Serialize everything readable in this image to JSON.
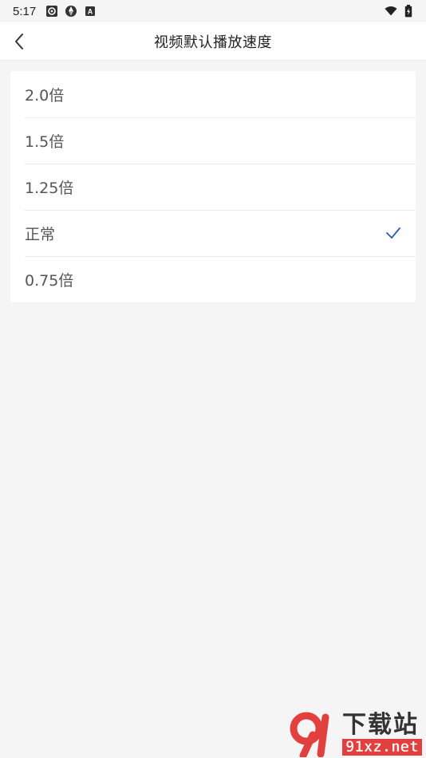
{
  "status_bar": {
    "time": "5:17",
    "left_icons": [
      "app-notification-icon",
      "aperture-icon",
      "a-letter-icon"
    ],
    "right_icons": [
      "wifi-icon",
      "battery-icon"
    ]
  },
  "header": {
    "title": "视频默认播放速度",
    "back_icon": "chevron-left-icon"
  },
  "options": [
    {
      "label": "2.0倍",
      "selected": false
    },
    {
      "label": "1.5倍",
      "selected": false
    },
    {
      "label": "1.25倍",
      "selected": false
    },
    {
      "label": "正常",
      "selected": true
    },
    {
      "label": "0.75倍",
      "selected": false
    }
  ],
  "watermark": {
    "cn": "下载站",
    "en": "91xz.net"
  },
  "colors": {
    "background": "#f5f5f5",
    "accent_check": "#2d5fa8",
    "watermark_red": "#e2403f"
  }
}
